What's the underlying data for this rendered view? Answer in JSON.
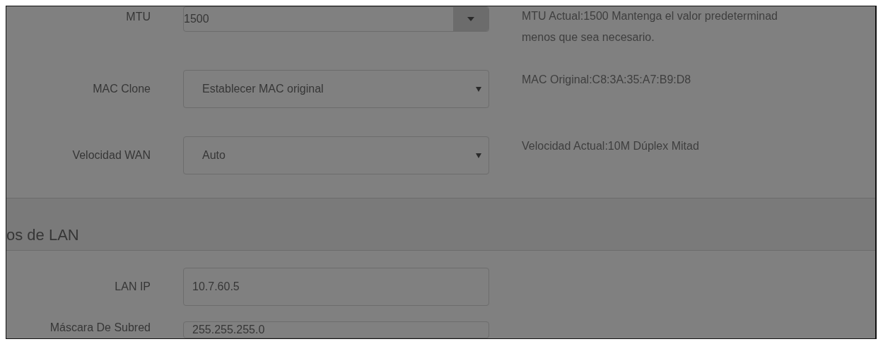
{
  "wan_rows": [
    {
      "label": "MTU",
      "kind": "spinner",
      "value": "1500",
      "help": [
        "MTU Actual:1500 Mantenga el valor predeterminad",
        "menos que sea necesario."
      ]
    },
    {
      "label": "MAC Clone",
      "kind": "select",
      "value": "Establecer MAC original",
      "help": [
        "MAC Original:C8:3A:35:A7:B9:D8"
      ]
    },
    {
      "label": "Velocidad WAN",
      "kind": "select",
      "value": "Auto",
      "help": [
        "Velocidad Actual:10M Dúplex Mitad"
      ]
    }
  ],
  "lan_section": {
    "title": "os de LAN",
    "rows": [
      {
        "label": "LAN IP",
        "kind": "text",
        "value": "10.7.60.5"
      },
      {
        "label": "Máscara De Subred",
        "kind": "text",
        "value": "255.255.255.0"
      }
    ]
  }
}
